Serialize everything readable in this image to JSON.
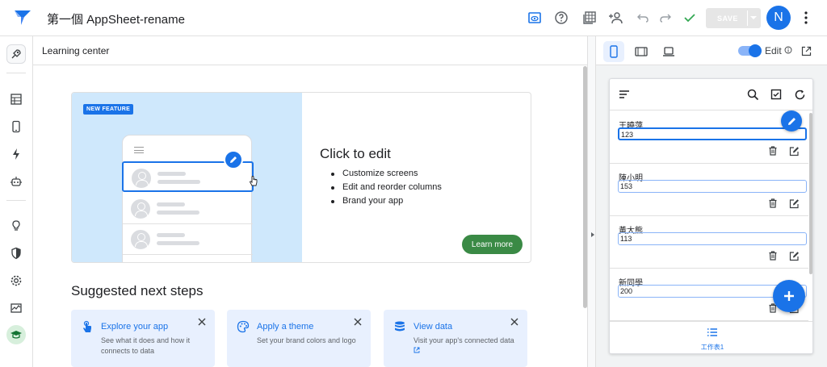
{
  "app": {
    "title": "第一個 AppSheet-rename",
    "save_label": "SAVE",
    "avatar_letter": "N"
  },
  "colors": {
    "accent": "#1a73e8",
    "success": "#34a853",
    "learn_button": "#3a8a45"
  },
  "toolbar_icons": [
    "preview-icon",
    "help-icon",
    "table-view-icon",
    "share-user-icon",
    "undo-icon",
    "redo-icon",
    "checkmark-icon",
    "more-vert-icon"
  ],
  "left_nav": [
    "deploy-icon",
    "data-icon",
    "views-icon",
    "automation-icon",
    "bot-icon",
    "intelligence-icon",
    "security-icon",
    "settings-icon",
    "monitor-icon",
    "learning-icon"
  ],
  "learning_center": {
    "title": "Learning center",
    "feature": {
      "badge": "NEW FEATURE",
      "heading": "Click to edit",
      "bullets": [
        "Customize screens",
        "Edit and reorder columns",
        "Brand your app"
      ],
      "button": "Learn more"
    },
    "suggested_title": "Suggested next steps",
    "suggestions": [
      {
        "title": "Explore your app",
        "desc": "See what it does and how it connects to data",
        "icon": "touch-icon"
      },
      {
        "title": "Apply a theme",
        "desc": "Set your brand colors and logo",
        "icon": "palette-icon"
      },
      {
        "title": "View data",
        "desc": "Visit your app's connected data",
        "icon": "database-icon"
      }
    ]
  },
  "preview": {
    "edit_label": "Edit",
    "edit_toggle": true,
    "rows": [
      {
        "name": "王曉萍",
        "value": "123"
      },
      {
        "name": "陳小明",
        "value": "153"
      },
      {
        "name": "黃大熊",
        "value": "113"
      },
      {
        "name": "新同學",
        "value": "200"
      }
    ],
    "tab_label": "工作表1"
  }
}
